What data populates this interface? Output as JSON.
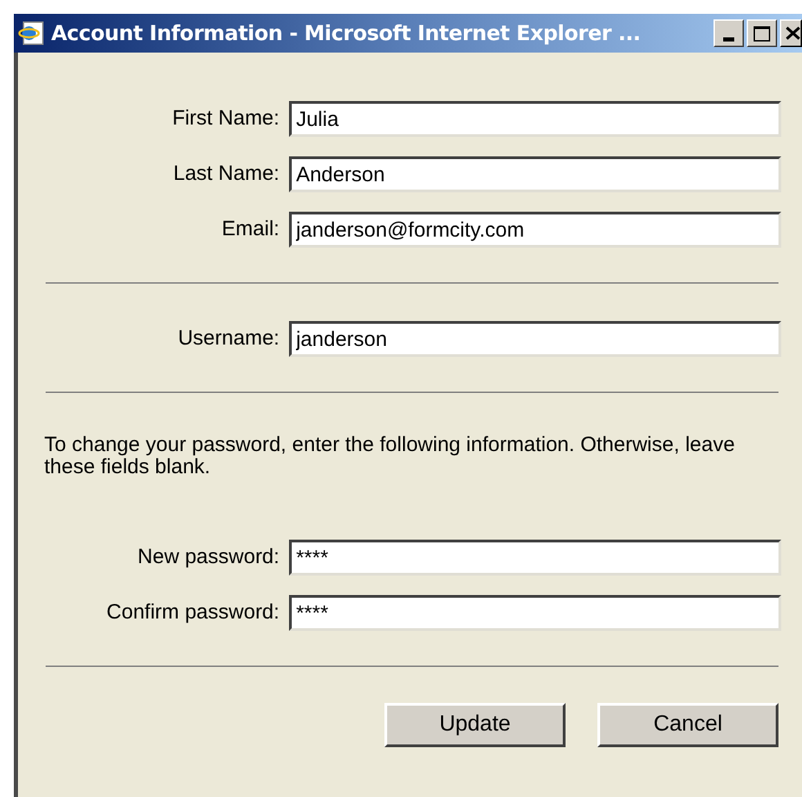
{
  "window": {
    "title": "Account Information - Microsoft Internet Explorer ..."
  },
  "sections": [
    {
      "kind": "fields",
      "fields": [
        {
          "label": "First Name:",
          "value": "Julia"
        },
        {
          "label": "Last Name:",
          "value": "Anderson"
        },
        {
          "label": "Email:",
          "value": "janderson@formcity.com"
        }
      ]
    },
    {
      "kind": "fields",
      "fields": [
        {
          "label": "Username:",
          "value": "janderson"
        }
      ]
    },
    {
      "kind": "note",
      "text": "To change your password, enter the following information. Otherwise, leave these fields blank."
    },
    {
      "kind": "fields",
      "fields": [
        {
          "label": "New password:",
          "value": "****"
        },
        {
          "label": "Confirm password:",
          "value": "****"
        }
      ]
    }
  ],
  "buttons": [
    "Update",
    "Cancel"
  ]
}
